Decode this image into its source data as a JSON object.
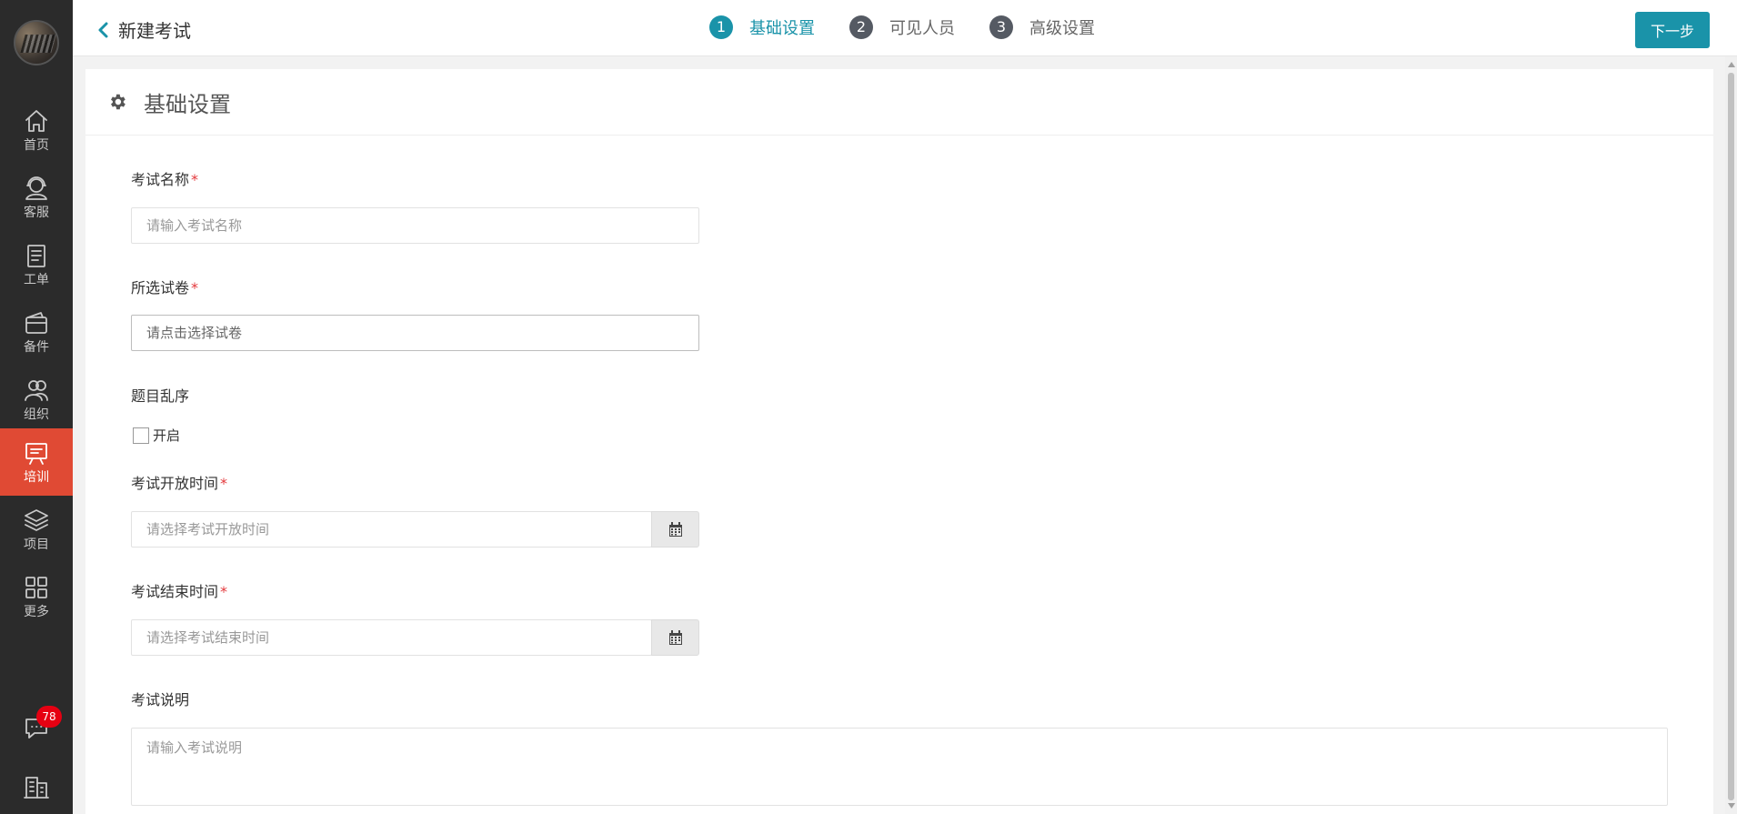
{
  "header": {
    "back_icon": "chevron-left-icon",
    "title": "新建考试",
    "next_label": "下一步"
  },
  "steps": [
    {
      "num": "1",
      "label": "基础设置",
      "active": true
    },
    {
      "num": "2",
      "label": "可见人员",
      "active": false
    },
    {
      "num": "3",
      "label": "高级设置",
      "active": false
    }
  ],
  "sidebar": {
    "items": [
      {
        "label": "首页",
        "icon": "home-icon"
      },
      {
        "label": "客服",
        "icon": "headset-icon"
      },
      {
        "label": "工单",
        "icon": "clipboard-icon"
      },
      {
        "label": "备件",
        "icon": "wallet-icon"
      },
      {
        "label": "组织",
        "icon": "users-icon"
      },
      {
        "label": "培训",
        "icon": "presentation-icon",
        "active": true
      },
      {
        "label": "项目",
        "icon": "layers-icon"
      },
      {
        "label": "更多",
        "icon": "grid-icon"
      }
    ],
    "message_badge": "78",
    "bottom_icons": [
      "chat-icon",
      "building-icon"
    ]
  },
  "panel": {
    "title": "基础设置",
    "icon": "gear-icon"
  },
  "form": {
    "exam_name": {
      "label": "考试名称",
      "required": "*",
      "placeholder": "请输入考试名称"
    },
    "paper": {
      "label": "所选试卷",
      "required": "*",
      "placeholder": "请点击选择试卷"
    },
    "shuffle": {
      "label": "题目乱序",
      "option": "开启",
      "checked": false
    },
    "open_time": {
      "label": "考试开放时间",
      "required": "*",
      "placeholder": "请选择考试开放时间"
    },
    "end_time": {
      "label": "考试结束时间",
      "required": "*",
      "placeholder": "请选择考试结束时间"
    },
    "description": {
      "label": "考试说明",
      "placeholder": "请输入考试说明"
    }
  },
  "colors": {
    "accent": "#1a93a9",
    "sidebar_bg": "#2b2b2b",
    "active_nav": "#e04a34",
    "required": "#e4393c",
    "badge": "#e60012"
  }
}
